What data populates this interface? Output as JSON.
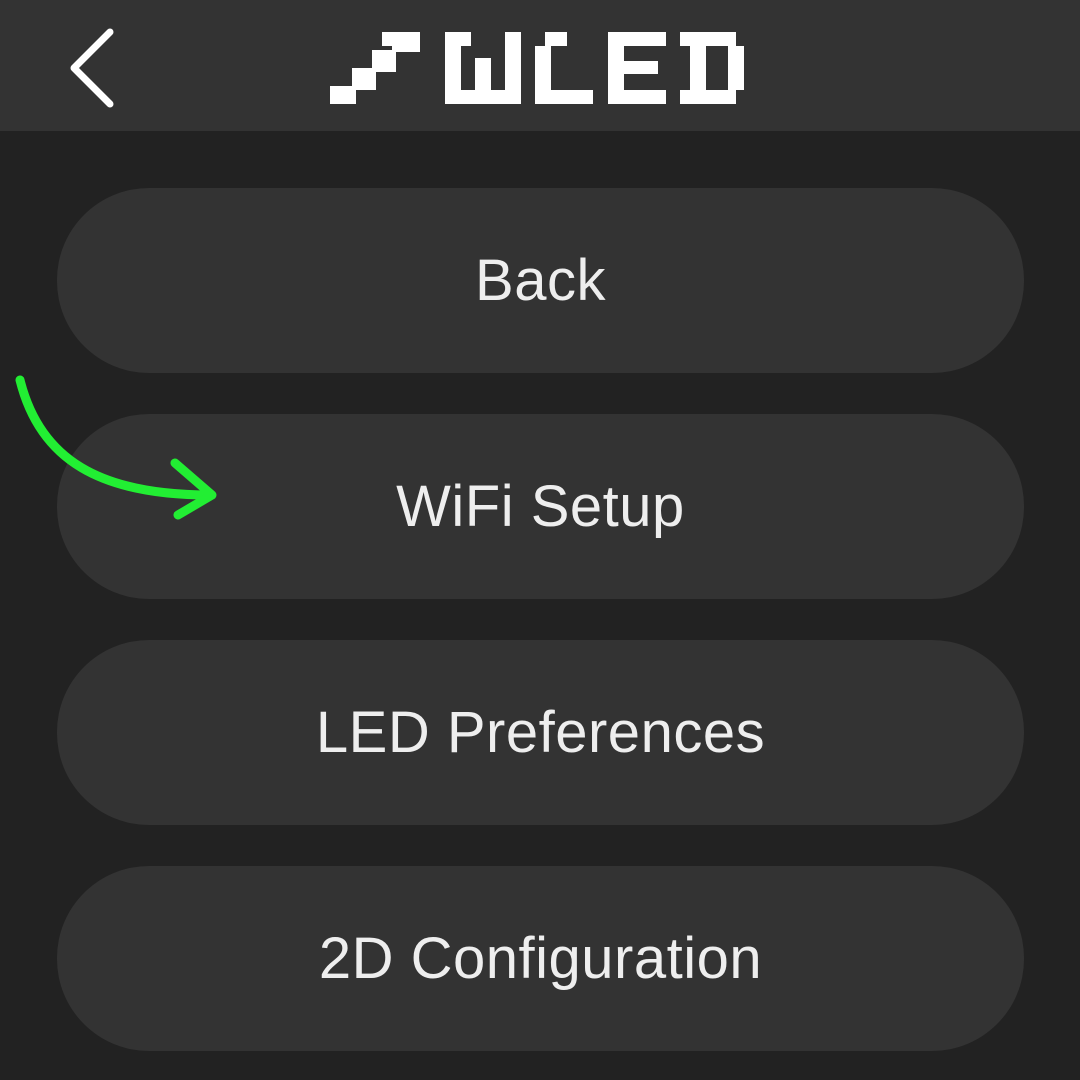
{
  "header": {
    "logo_text": "WLED",
    "back_icon": "chevron-left-icon"
  },
  "menu": {
    "items": [
      {
        "label": "Back"
      },
      {
        "label": "WiFi Setup"
      },
      {
        "label": "LED Preferences"
      },
      {
        "label": "2D Configuration"
      }
    ]
  },
  "annotation": {
    "icon": "curved-arrow-icon",
    "color": "#22ee33"
  },
  "colors": {
    "background": "#222222",
    "surface": "#333333",
    "text": "#eeeeee"
  }
}
